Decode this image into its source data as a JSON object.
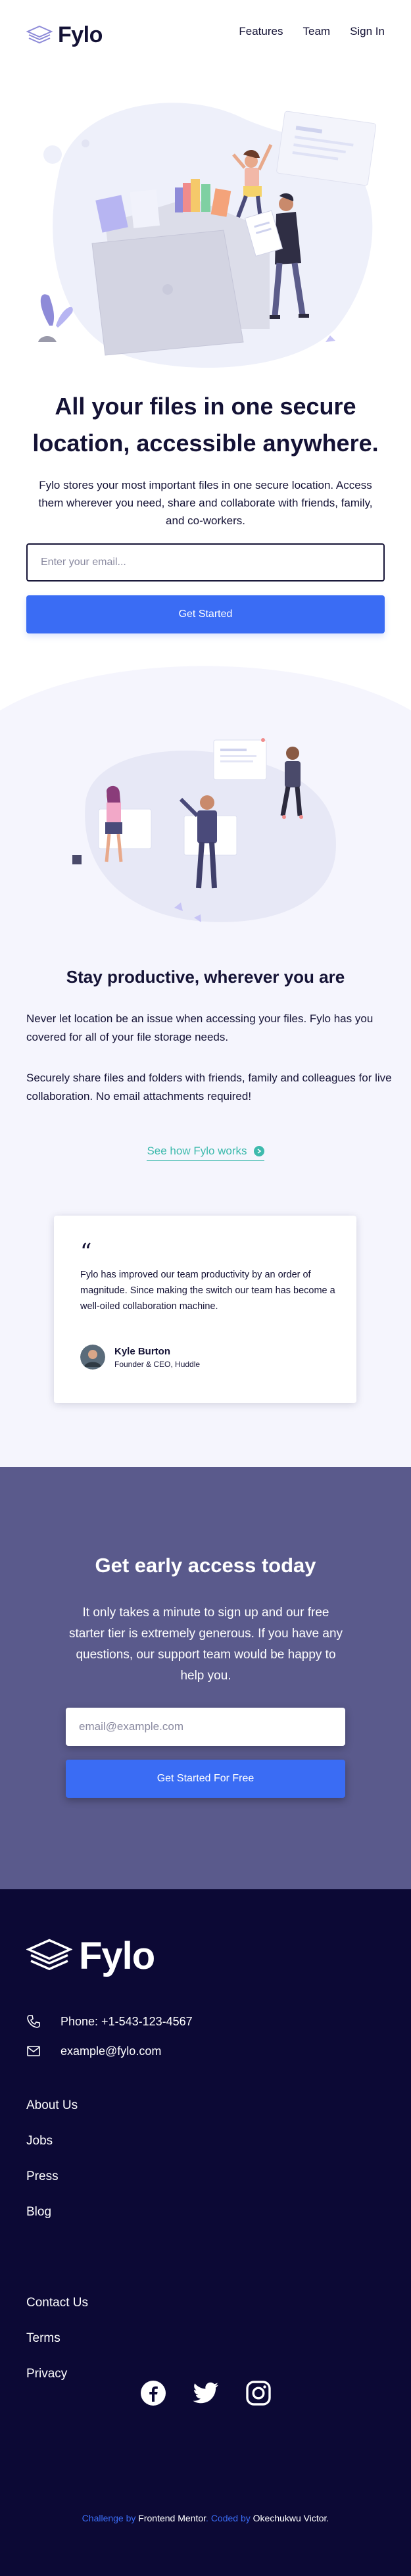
{
  "header": {
    "brand": "Fylo",
    "nav": [
      "Features",
      "Team",
      "Sign In"
    ]
  },
  "hero": {
    "title": "All your files in one secure location, accessible anywhere.",
    "text": "Fylo stores your most important files in one secure location. Access them wherever you need, share and collaborate with friends, family, and co-workers.",
    "email_placeholder": "Enter your email...",
    "cta": "Get Started"
  },
  "productive": {
    "title": "Stay productive, wherever you are",
    "p1": "Never let location be an issue when accessing your files. Fylo has you covered for all of your file storage needs.",
    "p2": "Securely share files and folders with friends, family and colleagues for live collaboration. No email attachments required!",
    "link": "See how Fylo works"
  },
  "testimonial": {
    "quote_mark": "“",
    "text": "Fylo has improved our team productivity by an order of magnitude. Since making the switch our team has become a well-oiled collaboration machine.",
    "name": "Kyle Burton",
    "role": "Founder & CEO, Huddle"
  },
  "early_access": {
    "title": "Get early access today",
    "text": "It only takes a minute to sign up and our free starter tier is extremely generous. If you have any questions, our support team would be happy to help you.",
    "email_placeholder": "email@example.com",
    "cta": "Get Started For Free"
  },
  "footer": {
    "brand": "Fylo",
    "phone": "Phone: +1-543-123-4567",
    "email": "example@fylo.com",
    "links_col1": [
      "About Us",
      "Jobs",
      "Press",
      "Blog"
    ],
    "links_col2": [
      "Contact Us",
      "Terms",
      "Privacy"
    ],
    "socials": [
      "facebook-icon",
      "twitter-icon",
      "instagram-icon"
    ],
    "attribution": {
      "challenge_prefix": "Challenge by",
      "challenge_name": "Frontend Mentor",
      "coded_prefix": "Coded by",
      "coded_name": "Okechukwu Victor."
    }
  },
  "colors": {
    "navy": "#141235",
    "blue": "#3a6cf4",
    "teal": "#3ebaad",
    "early_bg": "#5a5a8c",
    "footer_bg": "#0c0935",
    "light_bg": "#f5f5fd"
  }
}
